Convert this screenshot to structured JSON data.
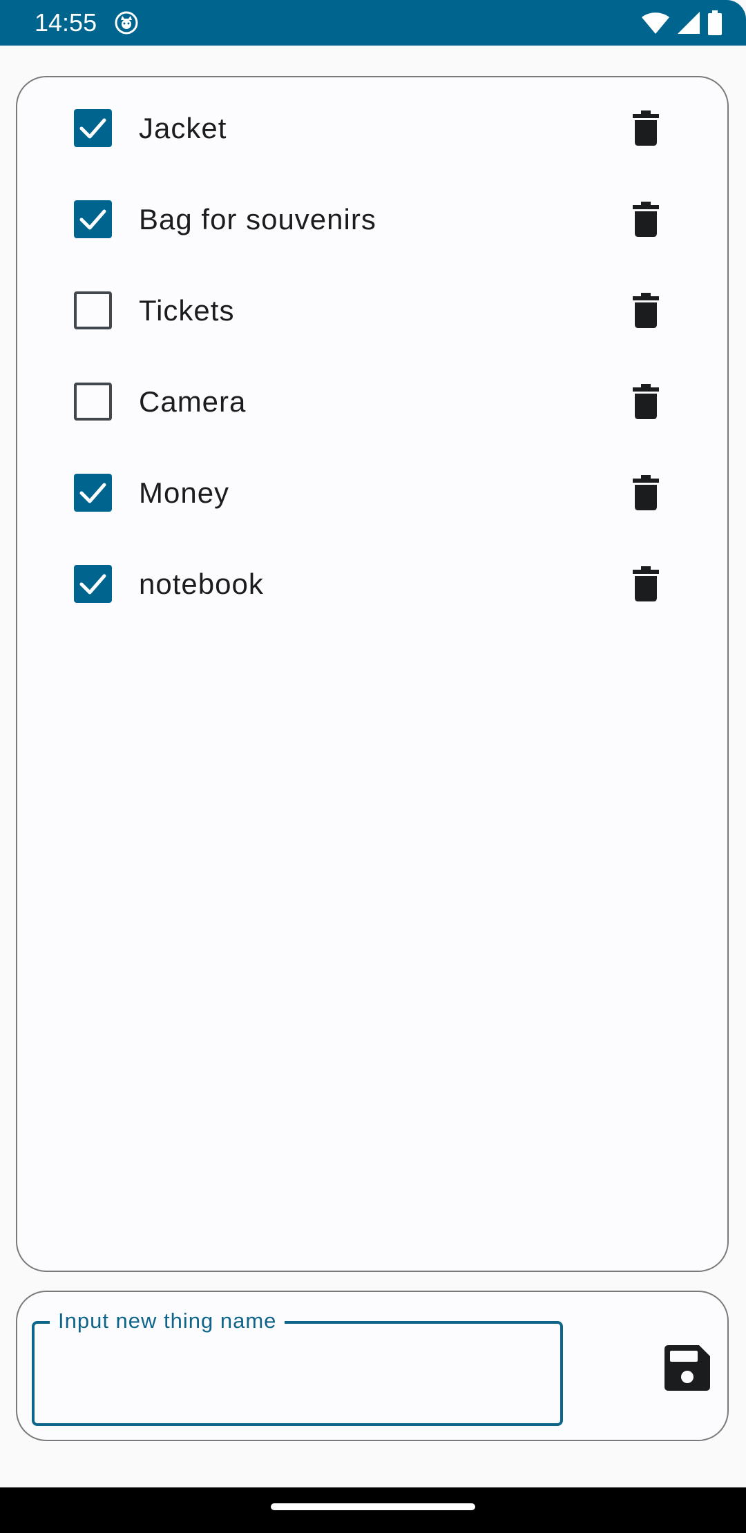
{
  "status_bar": {
    "time": "14:55",
    "app_icon": "cat-face-icon",
    "icons": [
      "wifi-icon",
      "signal-icon",
      "battery-icon"
    ],
    "background": "#00658E"
  },
  "items": [
    {
      "label": "Jacket",
      "checked": true
    },
    {
      "label": "Bag for souvenirs",
      "checked": true
    },
    {
      "label": "Tickets",
      "checked": false
    },
    {
      "label": "Camera",
      "checked": false
    },
    {
      "label": "Money",
      "checked": true
    },
    {
      "label": "notebook",
      "checked": true
    }
  ],
  "new_thing": {
    "label": "Input new thing name",
    "value": "",
    "save_icon": "save-icon"
  },
  "colors": {
    "accent": "#00658E",
    "text": "#1B1C1E",
    "outline": "#7A7A7A"
  }
}
